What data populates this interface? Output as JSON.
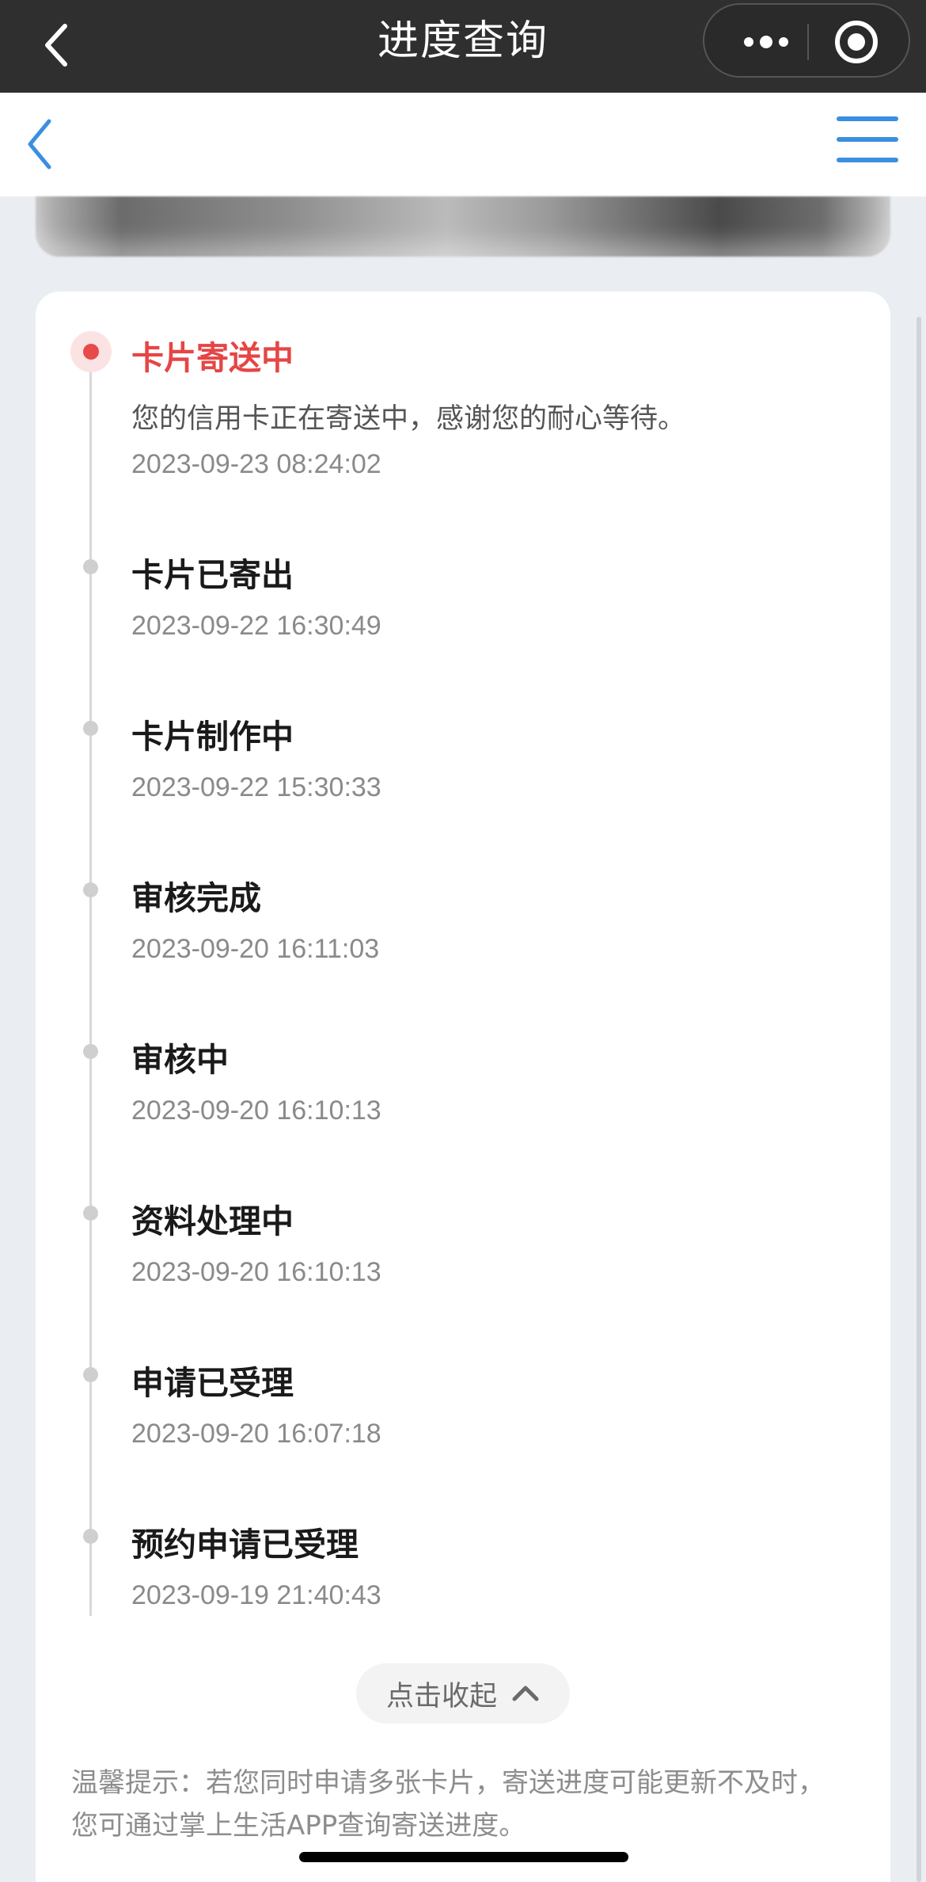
{
  "topbar": {
    "title": "进度查询",
    "back_icon": "chevron-left-icon",
    "more_icon": "more-dots-icon",
    "close_icon": "target-circle-icon"
  },
  "navbar": {
    "back_icon": "chevron-left-icon",
    "menu_icon": "hamburger-menu-icon",
    "accent_color": "#3a8fe0"
  },
  "timeline": {
    "active_color": "#e64545",
    "steps": [
      {
        "title": "卡片寄送中",
        "desc": "您的信用卡正在寄送中，感谢您的耐心等待。",
        "time": "2023-09-23 08:24:02",
        "active": true
      },
      {
        "title": "卡片已寄出",
        "time": "2023-09-22 16:30:49"
      },
      {
        "title": "卡片制作中",
        "time": "2023-09-22 15:30:33"
      },
      {
        "title": "审核完成",
        "time": "2023-09-20 16:11:03"
      },
      {
        "title": "审核中",
        "time": "2023-09-20 16:10:13"
      },
      {
        "title": "资料处理中",
        "time": "2023-09-20 16:10:13"
      },
      {
        "title": "申请已受理",
        "time": "2023-09-20 16:07:18"
      },
      {
        "title": "预约申请已受理",
        "time": "2023-09-19 21:40:43"
      }
    ]
  },
  "collapse": {
    "label": "点击收起",
    "icon": "chevron-up-icon"
  },
  "tip": {
    "text": "温馨提示：若您同时申请多张卡片，寄送进度可能更新不及时，您可通过掌上生活APP查询寄送进度。"
  }
}
